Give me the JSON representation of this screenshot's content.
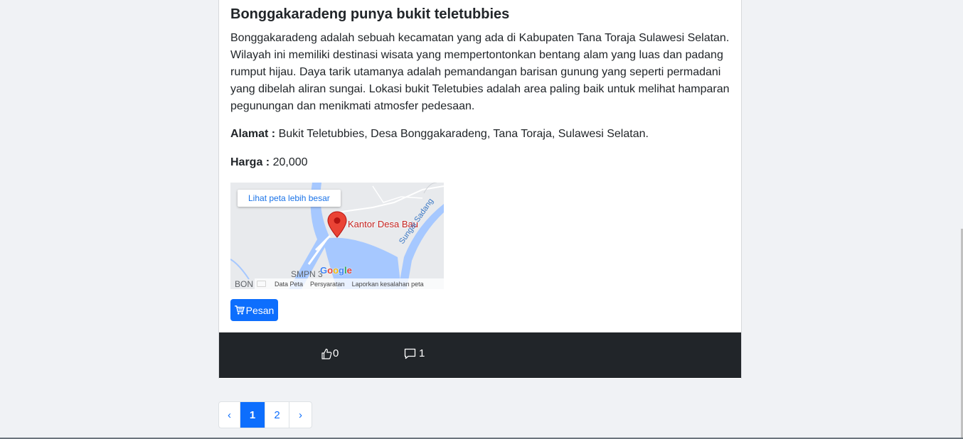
{
  "post": {
    "title": "Bonggakaradeng punya bukit teletubbies",
    "description_lines": [
      "Bonggakaradeng adalah sebuah kecamatan yang ada di Kabupaten Tana Toraja Sulawesi Selatan.",
      "Wilayah ini memiliki destinasi wisata yang mempertontonkan bentang alam yang luas dan padang",
      "rumput hijau. Daya tarik utamanya adalah pemandangan barisan gunung yang seperti permadani",
      "yang dibelah aliran sungai. Lokasi bukit Teletubies adalah area paling baik untuk melihat hamparan",
      "pegunungan dan menikmati atmosfer pedesaan."
    ],
    "address_label": "Alamat :",
    "address_value": "Bukit Teletubbies, Desa Bonggakaradeng, Tana Toraja, Sulawesi Selatan.",
    "price_label": "Harga :",
    "price_value": "20,000",
    "order_button": "Pesan"
  },
  "map": {
    "view_larger_link": "Lihat peta lebih besar",
    "pin_label": "Kantor Desa Bau",
    "river_label": "Sungai Sadang",
    "place_label_1": "SMPN 3",
    "place_label_2": "BON",
    "google_logo": "Google",
    "footer_data": "Data Peta",
    "footer_terms": "Persyaratan",
    "footer_report": "Laporkan kesalahan peta"
  },
  "footer": {
    "like_count": "0",
    "comment_count": "1"
  },
  "pagination": {
    "prev": "‹",
    "pages": [
      "1",
      "2"
    ],
    "next": "›",
    "active": "1"
  },
  "colors": {
    "primary": "#0d6efd",
    "dark_footer": "#212529",
    "background": "#f0f2f5"
  }
}
